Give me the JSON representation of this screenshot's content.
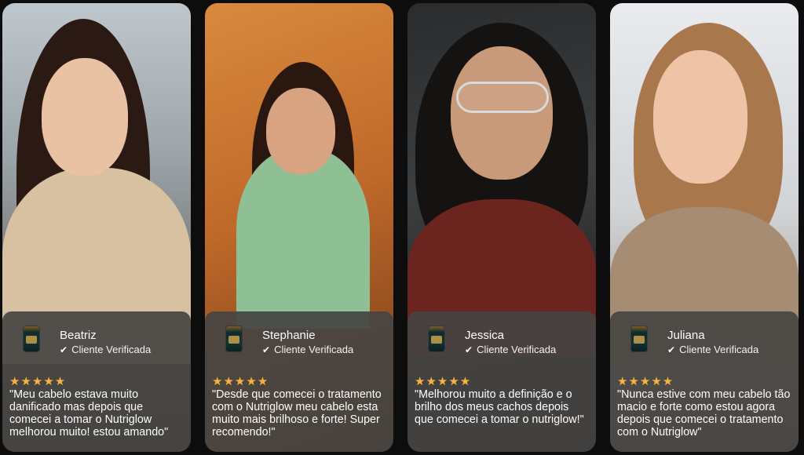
{
  "testimonials": [
    {
      "name": "Beatriz",
      "verified_label": "Cliente Verificada",
      "stars": "★★★★★",
      "quote": "\"Meu cabelo estava muito danificado mas depois que comecei a tomar o Nutriglow melhorou muito! estou amando\""
    },
    {
      "name": "Stephanie",
      "verified_label": "Cliente Verificada",
      "stars": "★★★★★",
      "quote": "\"Desde que comecei o tratamento com o Nutriglow meu cabelo esta muito mais brilhoso e forte! Super recomendo!\""
    },
    {
      "name": "Jessica",
      "verified_label": "Cliente Verificada",
      "stars": "★★★★★",
      "quote": "\"Melhorou muito a definição e o brilho dos meus cachos depois que comecei a tomar o nutriglow!\""
    },
    {
      "name": "Juliana",
      "verified_label": "Cliente Verificada",
      "stars": "★★★★★",
      "quote": "\"Nunca estive com meu cabelo tão macio e forte como estou agora depois que comecei o tratamento com o Nutriglow\""
    }
  ],
  "colors": {
    "star": "#f4b53f",
    "review_panel": "#464442"
  }
}
